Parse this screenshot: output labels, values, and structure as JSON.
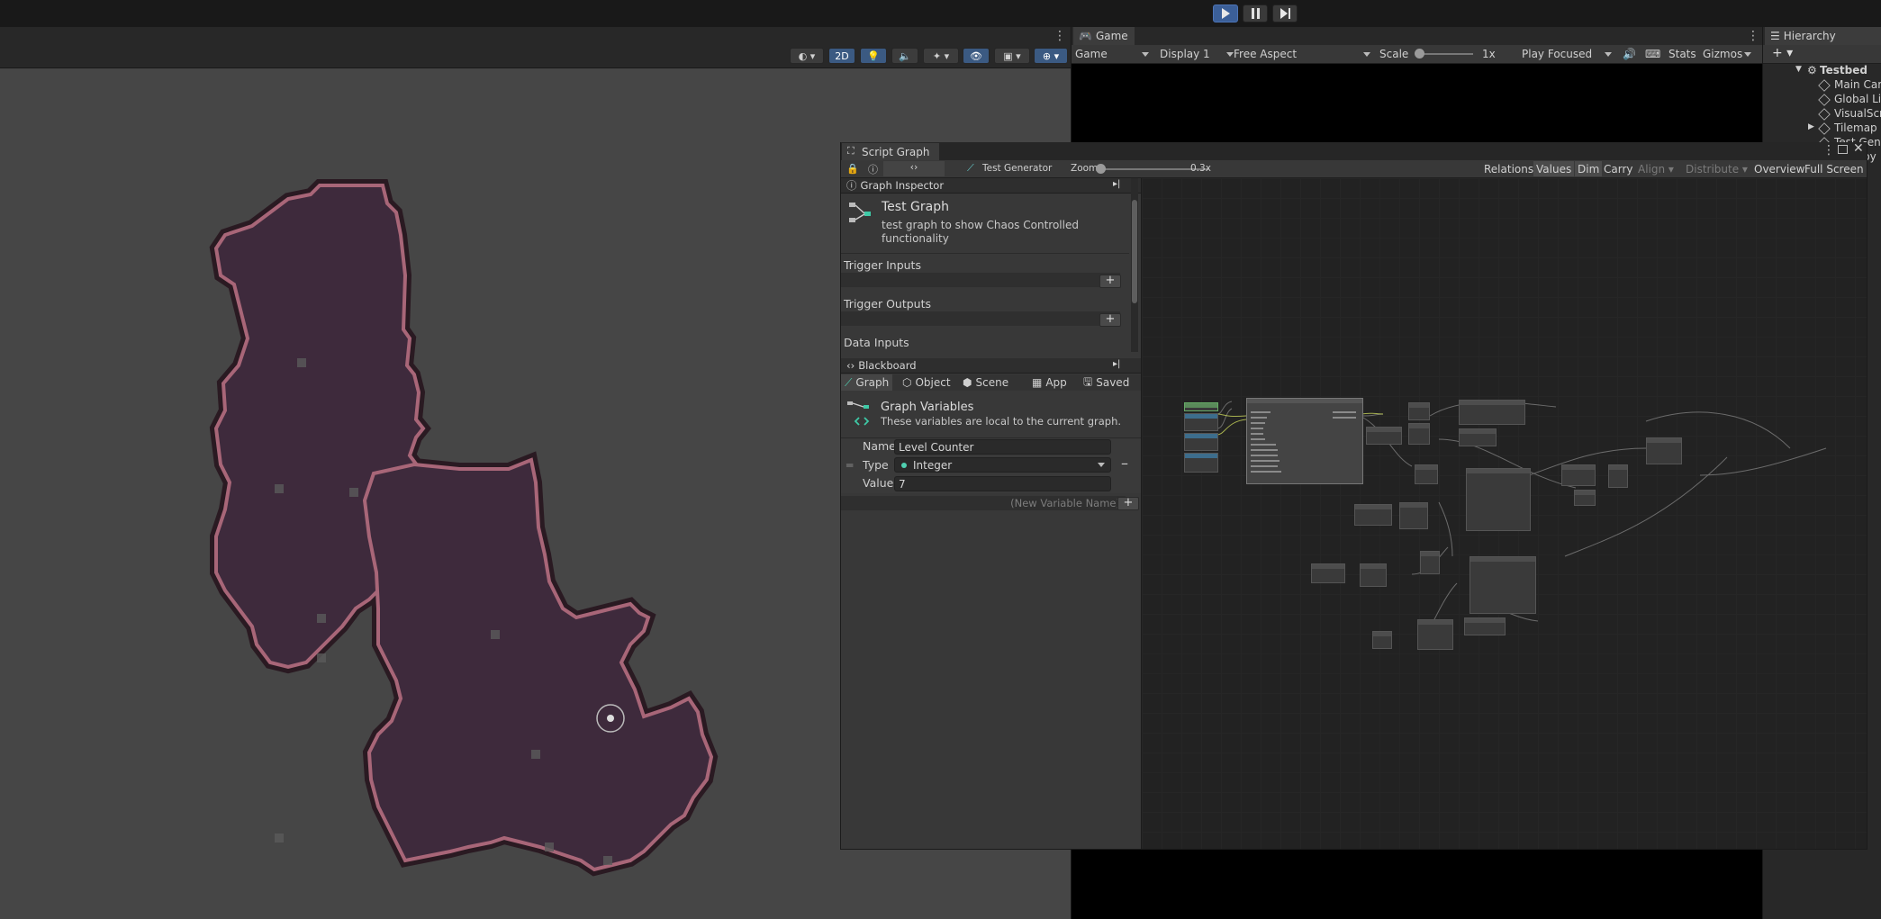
{
  "toolbar": {
    "play": "play",
    "pause": "pause",
    "step": "step"
  },
  "scene": {
    "toolbar_2d": "2D",
    "colors": {
      "floor": "#3e2a3c",
      "wall": "#6a3b4c",
      "brick": "#a86678",
      "background": "#464646"
    }
  },
  "game": {
    "tab": "Game",
    "mode": "Game",
    "display": "Display 1",
    "aspect": "Free Aspect",
    "scale_label": "Scale",
    "scale_value": "1x",
    "play_focused": "Play Focused",
    "stats": "Stats",
    "gizmos": "Gizmos"
  },
  "hierarchy": {
    "tab": "Hierarchy",
    "items": [
      {
        "label": "Testbed"
      },
      {
        "label": "Main Cam"
      },
      {
        "label": "Global Lig"
      },
      {
        "label": "VisualScr"
      },
      {
        "label": "Tilemap G"
      },
      {
        "label": "Test Gen"
      },
      {
        "label": "Destroy"
      }
    ]
  },
  "script_graph": {
    "tab": "Script Graph",
    "breadcrumb": "Test Generator",
    "zoom_label": "Zoom",
    "zoom_value": "0.3x",
    "graph_buttons": [
      "Relations",
      "Values",
      "Dim",
      "Carry",
      "Align",
      "Distribute",
      "Overview",
      "Full Screen"
    ],
    "inspector": {
      "header": "Graph Inspector",
      "title": "Test Graph",
      "description": "test graph to show Chaos Controlled functionality",
      "sections": [
        "Trigger Inputs",
        "Trigger Outputs",
        "Data Inputs"
      ]
    },
    "blackboard": {
      "header": "Blackboard",
      "tabs": [
        "Graph",
        "Object",
        "Scene",
        "App",
        "Saved"
      ],
      "title": "Graph Variables",
      "subtitle": "These variables are local to the current graph.",
      "name_label": "Name",
      "name_value": "Level Counter",
      "type_label": "Type",
      "type_value": "Integer",
      "value_label": "Value",
      "value_value": "7",
      "new_variable_placeholder": "(New Variable Name)"
    }
  }
}
